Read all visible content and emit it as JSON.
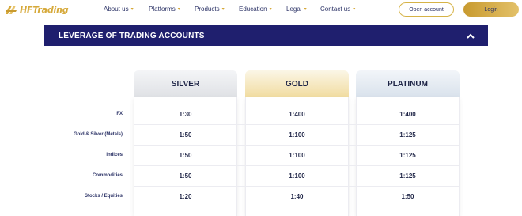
{
  "header": {
    "logo_text": "HFTrading",
    "nav": [
      {
        "label": "About us"
      },
      {
        "label": "Platforms"
      },
      {
        "label": "Products"
      },
      {
        "label": "Education"
      },
      {
        "label": "Legal"
      },
      {
        "label": "Contact us"
      }
    ],
    "open_account_label": "Open account",
    "login_label": "Login"
  },
  "section": {
    "title": "LEVERAGE OF TRADING ACCOUNTS",
    "toggle_icon": "chevron-up-icon"
  },
  "table": {
    "columns": [
      "SILVER",
      "GOLD",
      "PLATINUM"
    ],
    "rows": [
      {
        "label": "FX",
        "values": [
          "1:30",
          "1:400",
          "1:400"
        ]
      },
      {
        "label": "Gold & Silver (Metals)",
        "values": [
          "1:50",
          "1:100",
          "1:125"
        ]
      },
      {
        "label": "Indices",
        "values": [
          "1:50",
          "1:100",
          "1:125"
        ]
      },
      {
        "label": "Commodities",
        "values": [
          "1:50",
          "1:100",
          "1:125"
        ]
      },
      {
        "label": "Stocks / Equities",
        "values": [
          "1:20",
          "1:40",
          "1:50"
        ]
      }
    ]
  },
  "colors": {
    "navy": "#1f1f6e",
    "gold": "#d6a93a",
    "text": "#1f2547"
  }
}
